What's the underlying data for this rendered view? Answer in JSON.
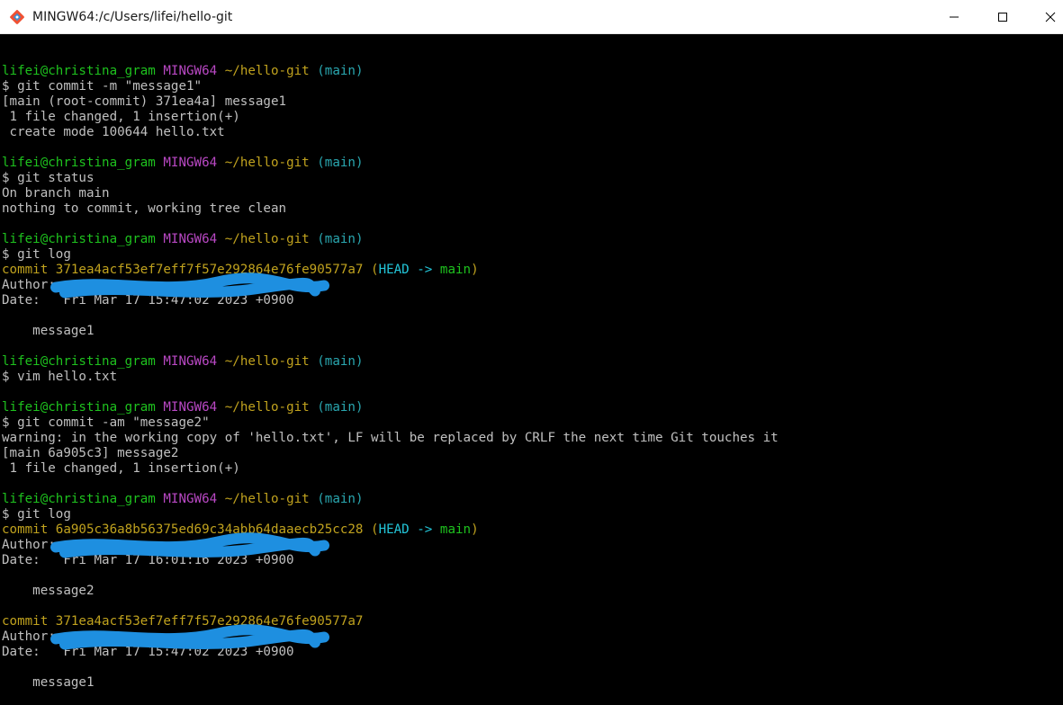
{
  "window": {
    "title": "MINGW64:/c/Users/lifei/hello-git",
    "icon": "git-bash-icon",
    "controls": {
      "minimize": "minimize-icon",
      "maximize": "maximize-icon",
      "close": "close-icon"
    }
  },
  "prompt": {
    "user_host": "lifei@christina_gram",
    "system": "MINGW64",
    "path": "~/hello-git",
    "branch": "(main)"
  },
  "colors": {
    "background": "#000000",
    "text": "#c0c0c0",
    "user_host": "#1ec21e",
    "system": "#b948c4",
    "path": "#c0a21e",
    "branch": "#2aa7b0",
    "commit_hash": "#c0a21e",
    "head_ref": "#23c6d9",
    "redaction": "#1e8fe0"
  },
  "blocks": [
    {
      "command": "$ git commit -m \"message1\"",
      "output": [
        "[main (root-commit) 371ea4a] message1",
        " 1 file changed, 1 insertion(+)",
        " create mode 100644 hello.txt"
      ]
    },
    {
      "command": "$ git status",
      "output": [
        "On branch main",
        "nothing to commit, working tree clean"
      ]
    },
    {
      "command": "$ git log",
      "commits": [
        {
          "label": "commit ",
          "hash": "371ea4acf53ef7eff7f57e292864e76fe90577a7",
          "ref_open": " (",
          "ref_head": "HEAD -> ",
          "ref_branch": "main",
          "ref_close": ")",
          "author": "Author: ",
          "date": "Date:   Fri Mar 17 15:47:02 2023 +0900",
          "message": "    message1"
        }
      ]
    },
    {
      "command": "$ vim hello.txt",
      "output": []
    },
    {
      "command": "$ git commit -am \"message2\"",
      "output": [
        "warning: in the working copy of 'hello.txt', LF will be replaced by CRLF the next time Git touches it",
        "[main 6a905c3] message2",
        " 1 file changed, 1 insertion(+)"
      ]
    },
    {
      "command": "$ git log",
      "commits": [
        {
          "label": "commit ",
          "hash": "6a905c36a8b56375ed69c34abb64daaecb25cc28",
          "ref_open": " (",
          "ref_head": "HEAD -> ",
          "ref_branch": "main",
          "ref_close": ")",
          "author": "Author: ",
          "date": "Date:   Fri Mar 17 16:01:16 2023 +0900",
          "message": "    message2"
        },
        {
          "label": "commit ",
          "hash": "371ea4acf53ef7eff7f57e292864e76fe90577a7",
          "author": "Author: ",
          "date": "Date:   Fri Mar 17 15:47:02 2023 +0900",
          "message": "    message1"
        }
      ]
    }
  ]
}
